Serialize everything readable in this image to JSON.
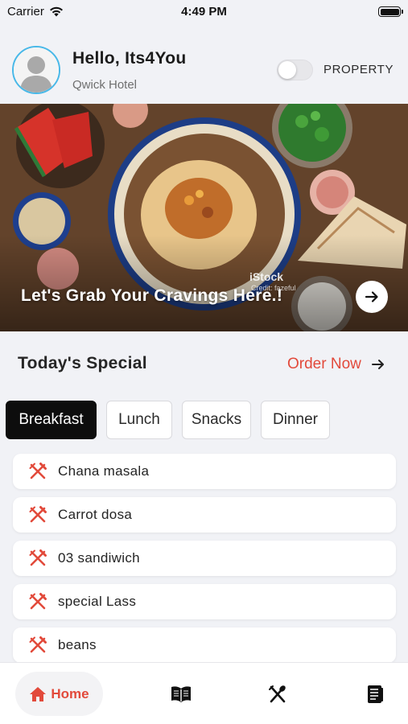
{
  "status_bar": {
    "carrier": "Carrier",
    "time": "4:49 PM",
    "battery_level": 1.0
  },
  "header": {
    "greeting": "Hello, Its4You",
    "hotel_name": "Qwick Hotel",
    "property_label": "PROPERTY",
    "property_toggle_on": false,
    "avatar_ring_color": "#48b8e8"
  },
  "banner": {
    "title": "Let's Grab Your Cravings Here.!",
    "watermark": "iStock",
    "watermark_credit": "Credit: fazeful",
    "arrow_icon": "arrow-right-icon"
  },
  "special": {
    "title": "Today's Special",
    "order_now_label": "Order Now",
    "order_now_icon": "arrow-right-icon",
    "accent_color": "#e24a3b"
  },
  "tabs": [
    {
      "label": "Breakfast",
      "active": true
    },
    {
      "label": "Lunch",
      "active": false
    },
    {
      "label": "Snacks",
      "active": false
    },
    {
      "label": "Dinner",
      "active": false
    }
  ],
  "items": [
    {
      "label": "Chana masala",
      "icon": "fork-knife-icon"
    },
    {
      "label": "Carrot dosa",
      "icon": "fork-knife-icon"
    },
    {
      "label": "03 sandiwich",
      "icon": "fork-knife-icon"
    },
    {
      "label": "special Lass",
      "icon": "fork-knife-icon"
    },
    {
      "label": "beans",
      "icon": "fork-knife-icon"
    }
  ],
  "bottom_nav": {
    "home_label": "Home",
    "items": [
      {
        "name": "home",
        "icon": "home-icon",
        "active": true
      },
      {
        "name": "menu",
        "icon": "menu-book-icon",
        "active": false
      },
      {
        "name": "dining",
        "icon": "fork-spoon-icon",
        "active": false
      },
      {
        "name": "orders",
        "icon": "receipt-icon",
        "active": false
      }
    ]
  }
}
